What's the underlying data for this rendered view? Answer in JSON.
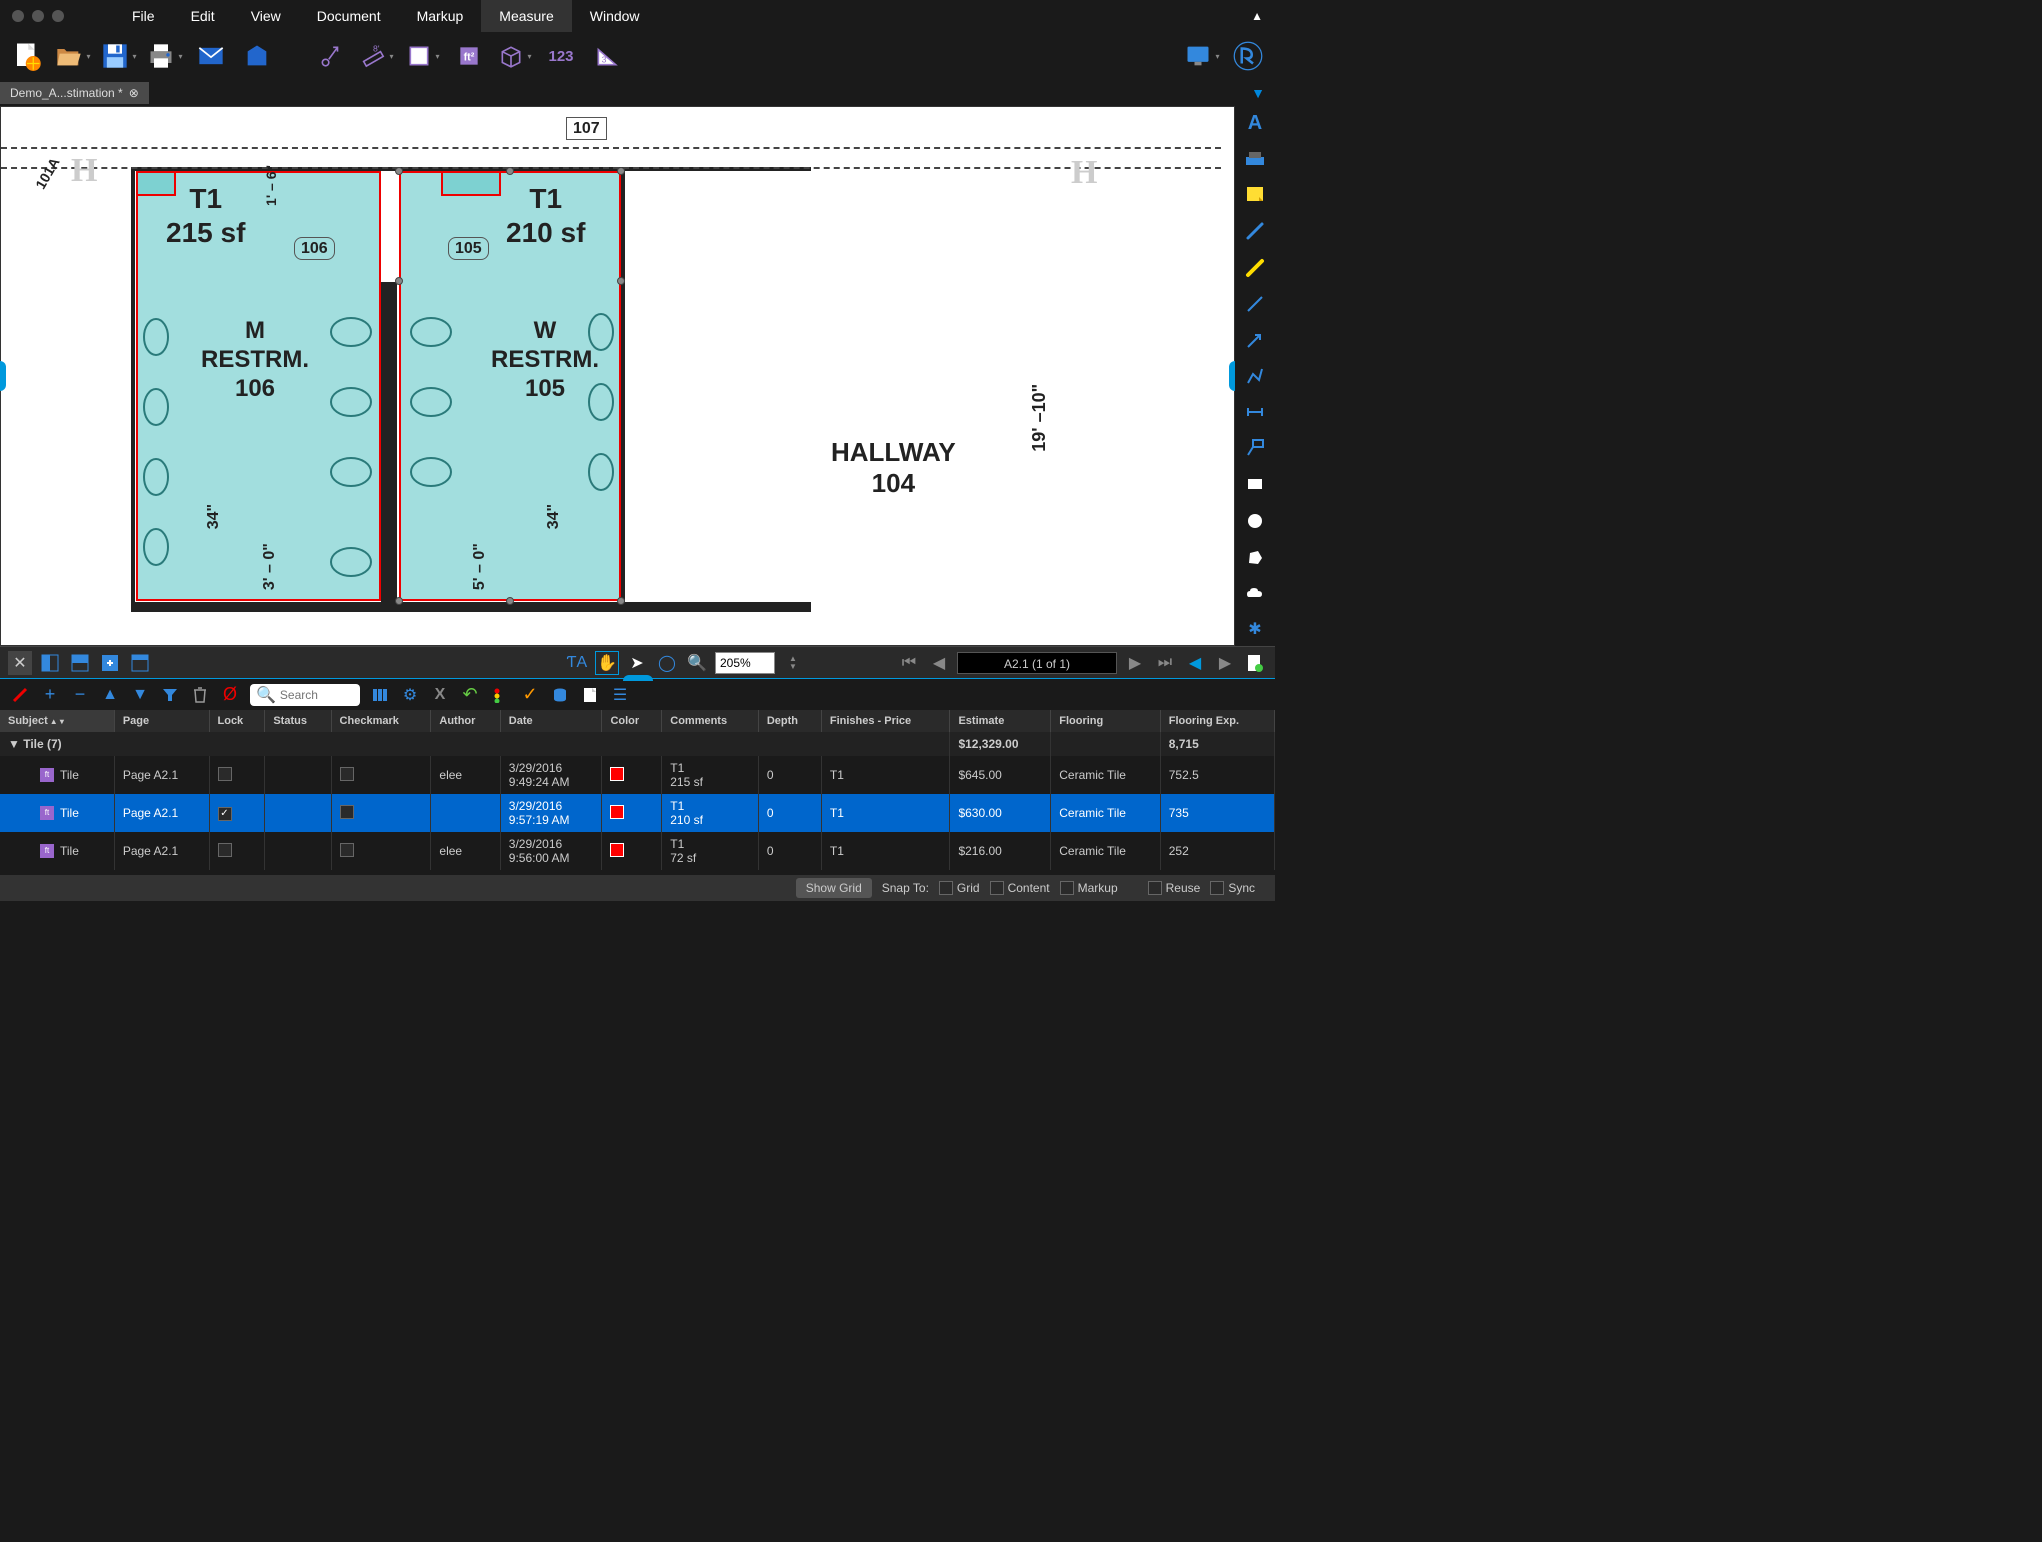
{
  "menubar": [
    "File",
    "Edit",
    "View",
    "Document",
    "Markup",
    "Measure",
    "Window"
  ],
  "active_menu": "Measure",
  "tab": {
    "name": "Demo_A...stimation *"
  },
  "zoom": "205%",
  "page_indicator": "A2.1 (1 of 1)",
  "search_placeholder": "Search",
  "blueprint": {
    "room1": {
      "tag": "T1",
      "area": "215 sf",
      "name": "M\nRESTRM.\n106"
    },
    "room2": {
      "tag": "T1",
      "area": "210 sf",
      "name": "W\nRESTRM.\n105"
    },
    "hallway": "HALLWAY\n104",
    "dim1": "19' –10\"",
    "dim2": "34\"",
    "dim3": "3' – 0\"",
    "dim4": "5' – 0\"",
    "dim5": "34\"",
    "door1": "106",
    "door2": "105",
    "door3": "107",
    "door4": "101A",
    "topdim": "1' – 6\""
  },
  "columns": [
    "Subject",
    "Page",
    "Lock",
    "Status",
    "Checkmark",
    "Author",
    "Date",
    "Color",
    "Comments",
    "Depth",
    "Finishes - Price",
    "Estimate",
    "Flooring",
    "Flooring Exp."
  ],
  "group": {
    "label": "Tile (7)",
    "estimate": "$12,329.00",
    "flooring_exp": "8,715"
  },
  "rows": [
    {
      "subject": "Tile",
      "page": "Page A2.1",
      "locked": false,
      "author": "elee",
      "date": "3/29/2016\n9:49:24 AM",
      "comments": "T1\n215 sf",
      "depth": "0",
      "finishes": "T1",
      "estimate": "$645.00",
      "flooring": "Ceramic Tile",
      "flooring_exp": "752.5",
      "selected": false
    },
    {
      "subject": "Tile",
      "page": "Page A2.1",
      "locked": true,
      "author": "",
      "date": "3/29/2016\n9:57:19 AM",
      "comments": "T1\n210 sf",
      "depth": "0",
      "finishes": "T1",
      "estimate": "$630.00",
      "flooring": "Ceramic Tile",
      "flooring_exp": "735",
      "selected": true
    },
    {
      "subject": "Tile",
      "page": "Page A2.1",
      "locked": false,
      "author": "elee",
      "date": "3/29/2016\n9:56:00 AM",
      "comments": "T1\n72 sf",
      "depth": "0",
      "finishes": "T1",
      "estimate": "$216.00",
      "flooring": "Ceramic Tile",
      "flooring_exp": "252",
      "selected": false
    }
  ],
  "statusbar": {
    "show_grid": "Show Grid",
    "snap_to": "Snap To:",
    "snaps": [
      "Grid",
      "Content",
      "Markup",
      "Reuse",
      "Sync"
    ]
  },
  "toolbar_number": "123"
}
